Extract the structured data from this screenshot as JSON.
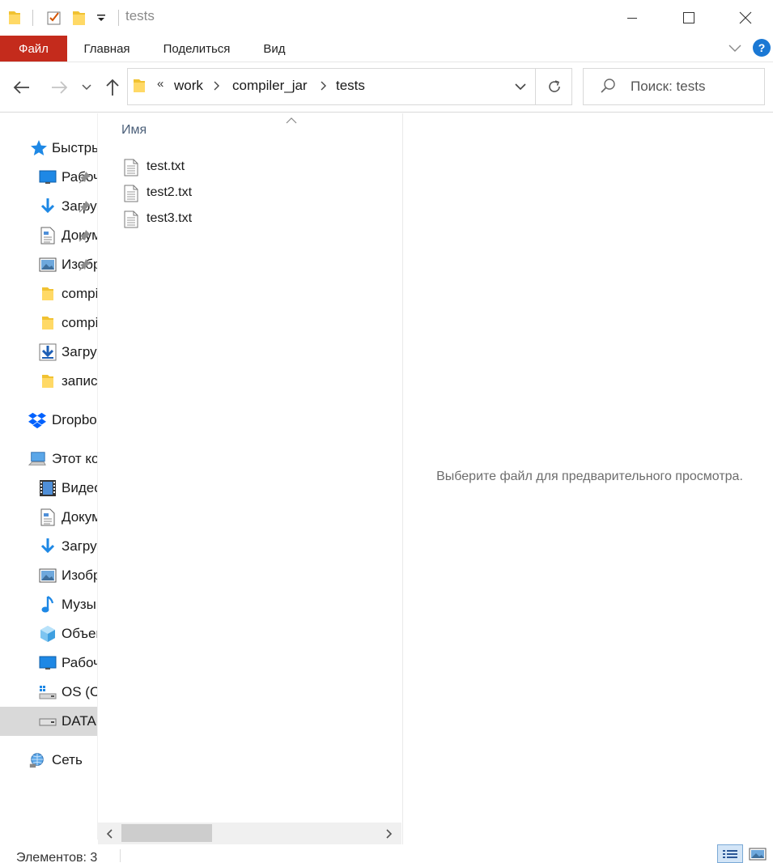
{
  "window": {
    "title": "tests",
    "minimize": "–",
    "maximize": "□",
    "close": "✕"
  },
  "ribbon": {
    "tabs": [
      "Файл",
      "Главная",
      "Поделиться",
      "Вид"
    ],
    "help": "?"
  },
  "address": {
    "more": "«",
    "crumbs": [
      "work",
      "compiler_jar",
      "tests"
    ]
  },
  "search": {
    "placeholder": "Поиск: tests"
  },
  "sidebar": {
    "items": [
      {
        "label": "Быстрый доступ",
        "icon": "star-icon"
      },
      {
        "label": "Рабочий стол",
        "icon": "desktop-icon",
        "pinned": true
      },
      {
        "label": "Загрузки",
        "icon": "download-icon",
        "pinned": true
      },
      {
        "label": "Документы",
        "icon": "document-icon",
        "pinned": true
      },
      {
        "label": "Изображения",
        "icon": "pictures-icon",
        "pinned": true
      },
      {
        "label": "compiler",
        "icon": "folder-icon"
      },
      {
        "label": "compiler",
        "icon": "folder-icon"
      },
      {
        "label": "Загрузки",
        "icon": "download-box-icon"
      },
      {
        "label": "записи",
        "icon": "folder-icon"
      },
      {
        "label": "Dropbox",
        "icon": "dropbox-icon"
      },
      {
        "label": "Этот компьютер",
        "icon": "computer-icon"
      },
      {
        "label": "Видео",
        "icon": "video-icon"
      },
      {
        "label": "Документы",
        "icon": "document-icon"
      },
      {
        "label": "Загрузки",
        "icon": "download-icon"
      },
      {
        "label": "Изображения",
        "icon": "pictures-icon"
      },
      {
        "label": "Музыка",
        "icon": "music-icon"
      },
      {
        "label": "Объемные объекты",
        "icon": "3d-objects-icon"
      },
      {
        "label": "Рабочий стол",
        "icon": "desktop-icon"
      },
      {
        "label": "OS (C:)",
        "icon": "os-drive-icon"
      },
      {
        "label": "DATA",
        "icon": "drive-icon",
        "selected": true
      },
      {
        "label": "Сеть",
        "icon": "network-icon"
      }
    ]
  },
  "filelist": {
    "column_name": "Имя",
    "files": [
      "test.txt",
      "test2.txt",
      "test3.txt"
    ]
  },
  "preview": {
    "message": "Выберите файл для предварительного просмотра."
  },
  "status": {
    "items_text": "Элементов: 3"
  },
  "colors": {
    "file_tab": "#c42b1c",
    "accent": "#1a78d4",
    "selection": "#d9d9d9"
  }
}
